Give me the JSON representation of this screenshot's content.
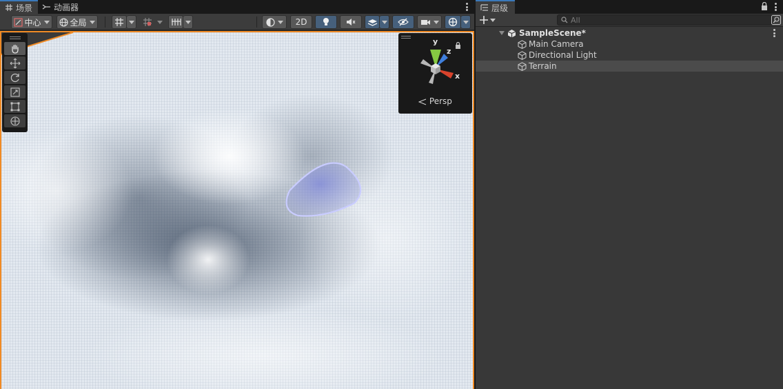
{
  "scene_tabs": {
    "scene_label": "场景",
    "animator_label": "动画器"
  },
  "scene_toolbar": {
    "pivot_label": "中心",
    "space_label": "全局",
    "mode_2d_label": "2D"
  },
  "gizmo": {
    "persp_label": "Persp",
    "axis_y": "y",
    "axis_z": "z",
    "axis_x": "x"
  },
  "hierarchy": {
    "tab_label": "层级",
    "search_placeholder": "All",
    "scene_name": "SampleScene*",
    "items": [
      {
        "label": "Main Camera"
      },
      {
        "label": "Directional Light"
      },
      {
        "label": "Terrain",
        "selected": true
      }
    ]
  },
  "colors": {
    "accent_blue": "#3a79bb",
    "selection_orange": "#f08a24",
    "active_toggle": "#46607c"
  }
}
